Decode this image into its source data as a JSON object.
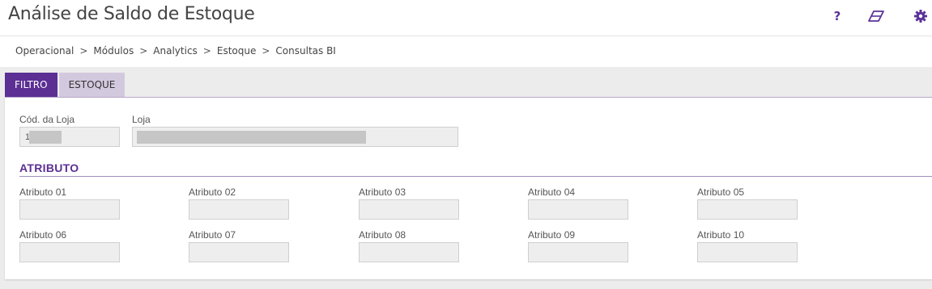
{
  "header": {
    "title": "Análise de Saldo de Estoque",
    "icons": [
      "help-icon",
      "eraser-icon",
      "gear-icon"
    ],
    "help_glyph": "?"
  },
  "breadcrumb": [
    "Operacional",
    "Módulos",
    "Analytics",
    "Estoque",
    "Consultas BI"
  ],
  "breadcrumb_separator": ">",
  "tabs": [
    {
      "label": "FILTRO",
      "active": true
    },
    {
      "label": "ESTOQUE",
      "active": false
    }
  ],
  "form": {
    "cod_loja_label": "Cód. da Loja",
    "cod_loja_value": "11",
    "loja_label": "Loja",
    "loja_value": ""
  },
  "section": {
    "title": "ATRIBUTO"
  },
  "atributos": [
    {
      "label": "Atributo 01",
      "value": ""
    },
    {
      "label": "Atributo 02",
      "value": ""
    },
    {
      "label": "Atributo 03",
      "value": ""
    },
    {
      "label": "Atributo 04",
      "value": ""
    },
    {
      "label": "Atributo 05",
      "value": ""
    },
    {
      "label": "Atributo 06",
      "value": ""
    },
    {
      "label": "Atributo 07",
      "value": ""
    },
    {
      "label": "Atributo 08",
      "value": ""
    },
    {
      "label": "Atributo 09",
      "value": ""
    },
    {
      "label": "Atributo 10",
      "value": ""
    }
  ],
  "colors": {
    "accent": "#5b2f93",
    "tab_inactive": "#d3c9de",
    "field_bg": "#eeeeee"
  }
}
